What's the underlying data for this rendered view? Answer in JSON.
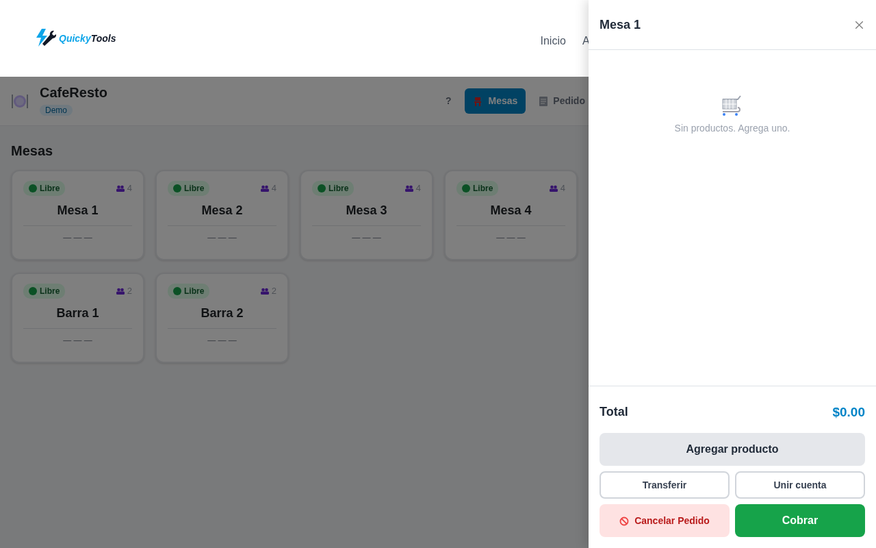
{
  "header": {
    "logo": [
      "Quicky",
      "Tools"
    ],
    "nav": [
      "Inicio",
      "A"
    ]
  },
  "app": {
    "name": "CafeResto",
    "badge": "Demo",
    "help": "?",
    "tabs": [
      {
        "label": "Mesas",
        "selected": true
      },
      {
        "label": "Pedido",
        "selected": false
      }
    ]
  },
  "section_title": "Mesas",
  "tables": [
    {
      "status": "Libre",
      "seats": "4",
      "name": "Mesa 1",
      "order": "— — —"
    },
    {
      "status": "Libre",
      "seats": "4",
      "name": "Mesa 2",
      "order": "— — —"
    },
    {
      "status": "Libre",
      "seats": "4",
      "name": "Mesa 3",
      "order": "— — —"
    },
    {
      "status": "Libre",
      "seats": "4",
      "name": "Mesa 4",
      "order": "— — —"
    },
    {
      "status": "Libre",
      "seats": "2",
      "name": "Barra 1",
      "order": "— — —"
    },
    {
      "status": "Libre",
      "seats": "2",
      "name": "Barra 2",
      "order": "— — —"
    }
  ],
  "panel": {
    "title": "Mesa 1",
    "empty_text": "Sin productos. Agrega uno.",
    "total_label": "Total",
    "total": "$0.00",
    "buttons": [
      {
        "kind": "add",
        "label": "Agregar producto"
      },
      {
        "kind": "outline",
        "label": "Transferir"
      },
      {
        "kind": "outline",
        "label": "Unir cuenta"
      },
      {
        "kind": "cancel",
        "label": "Cancelar Pedido"
      },
      {
        "kind": "pay",
        "label": "Cobrar"
      }
    ]
  }
}
